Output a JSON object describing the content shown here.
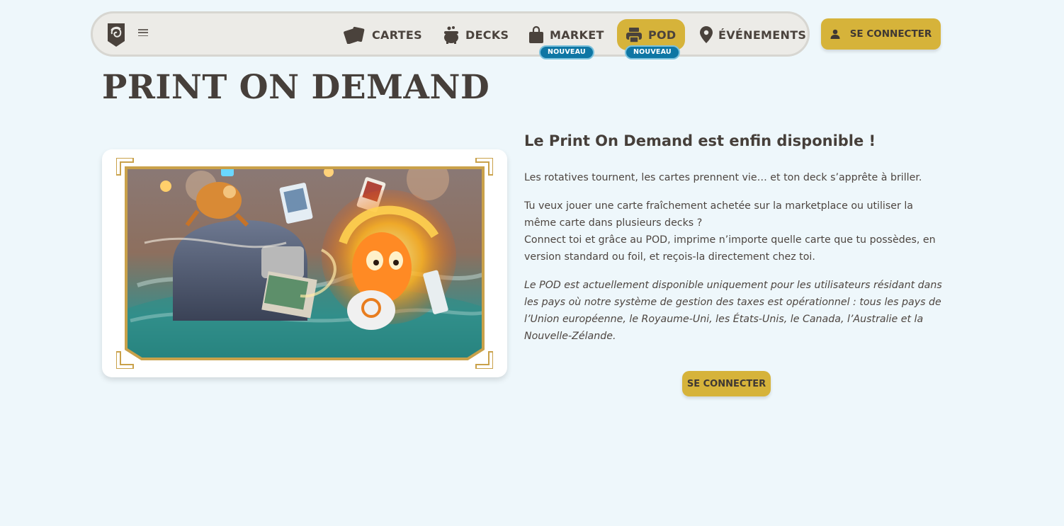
{
  "nav": {
    "logo_icon": "spiral-shield-logo",
    "menu_icon": "hamburger-icon",
    "items": [
      {
        "label": "CARTES",
        "icon": "cards-icon"
      },
      {
        "label": "DECKS",
        "icon": "cauldron-icon"
      },
      {
        "label": "MARKET",
        "icon": "shopping-bag-icon",
        "badge": "NOUVEAU"
      },
      {
        "label": "POD",
        "icon": "printer-icon",
        "badge": "NOUVEAU",
        "active": true
      },
      {
        "label": "ÉVÉNEMENTS",
        "icon": "map-pin-icon"
      }
    ],
    "login_label": "SE CONNECTER",
    "login_icon": "user-icon"
  },
  "page": {
    "title": "PRINT ON DEMAND",
    "hero_image": "print-on-demand-illustration",
    "headline": "Le Print On Demand est enfin disponible !",
    "paragraph1": "Les rotatives tournent, les cartes prennent vie… et ton deck s’apprête à briller.",
    "paragraph2_line1": "Tu veux jouer une carte fraîchement achetée sur la marketplace ou utiliser la même carte dans plusieurs decks ?",
    "paragraph2_line2": "Connect toi et grâce au POD, imprime n’importe quelle carte que tu possèdes, en version standard ou foil, et reçois-la directement chez toi.",
    "notice": "Le POD est actuellement disponible uniquement pour les utilisateurs résidant dans les pays où notre système de gestion des taxes est opérationnel : tous les pays de l’Union européenne, le Royaume-Uni, les États-Unis, le Canada, l’Australie et la Nouvelle-Zélande.",
    "login_label": "SE CONNECTER"
  },
  "colors": {
    "background": "#eef7fb",
    "accent_gold": "#d6b33a",
    "badge_blue": "#0e76a4",
    "text_dark": "#463f3a",
    "nav_bg": "#ecebe7"
  }
}
